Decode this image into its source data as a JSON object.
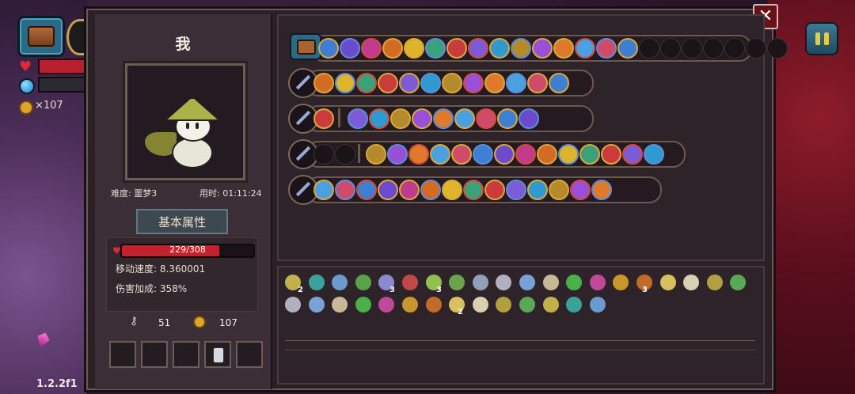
{
  "hud": {
    "coin_count": "×107",
    "version": "1.2.2f1"
  },
  "character": {
    "name": "我",
    "difficulty": "难度: 噩梦3",
    "playtime": "用时: 01:11:24",
    "attributes_tab": "基本属性",
    "hp_text": "229/308",
    "hp_fraction": 0.7435,
    "move_speed": "移动速度: 8.360001",
    "damage_bonus": "伤害加成: 358%",
    "keys": "51",
    "coins": "107"
  },
  "colors": {
    "hp": "#c71f2d",
    "frame_gold": "#d9a83a",
    "close_button": "#6b1015"
  },
  "icons": [
    "chest-icon",
    "wand-icon",
    "pause-icon",
    "close-icon",
    "key-icon",
    "coin-icon",
    "heart-icon",
    "mana-icon",
    "potion-icon"
  ],
  "weapon_rows": [
    {
      "name": "chest",
      "icons": 15,
      "empty": 7
    },
    {
      "name": "wand-1",
      "icons": 12
    },
    {
      "name": "wand-2",
      "icons": 10
    },
    {
      "name": "wand-3",
      "icons": 14
    },
    {
      "name": "wand-4",
      "icons": 14
    }
  ],
  "inventory_badges": [
    "2",
    "3",
    "3",
    "3",
    "2"
  ]
}
